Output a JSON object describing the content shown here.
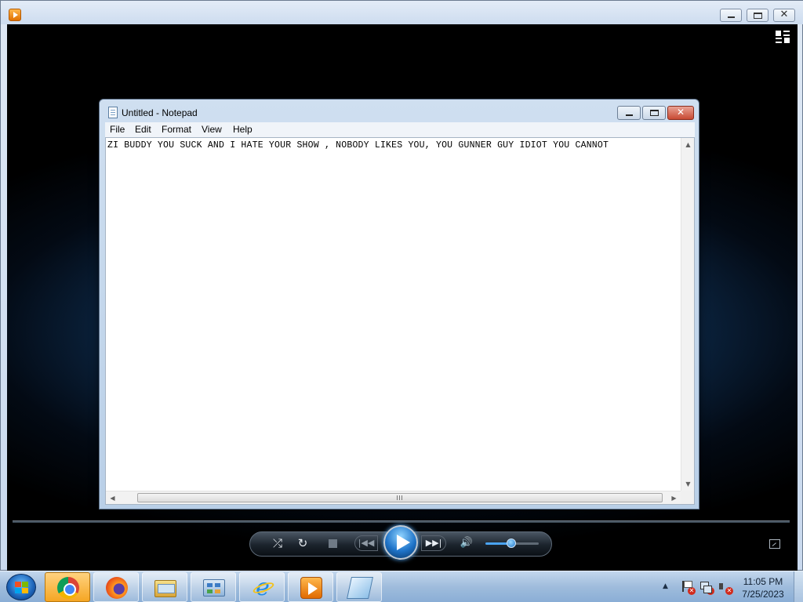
{
  "wmp": {
    "window_title": "",
    "controls": {
      "shuffle": "⤮",
      "repeat": "↻",
      "prev": "|◀◀",
      "next": "▶▶|",
      "mute": "🔊",
      "volume_fraction": 0.48
    }
  },
  "notepad": {
    "title": "Untitled - Notepad",
    "menu": [
      "File",
      "Edit",
      "Format",
      "View",
      "Help"
    ],
    "content": "ZI BUDDY YOU SUCK AND I HATE YOUR SHOW , NOBODY LIKES YOU, YOU GUNNER GUY IDIOT YOU CANNOT"
  },
  "taskbar": {
    "apps": [
      "chrome-icon",
      "firefox-icon",
      "explorer-icon",
      "control-panel-icon",
      "internet-explorer-icon",
      "media-player-icon",
      "notepad-icon"
    ],
    "clock": {
      "time": "11:05 PM",
      "date": "7/25/2023"
    }
  },
  "colors": {
    "taskbar": "#9fbcdc",
    "active_taskbar_button": "#f5a623",
    "play_button": "#1f74c9"
  }
}
